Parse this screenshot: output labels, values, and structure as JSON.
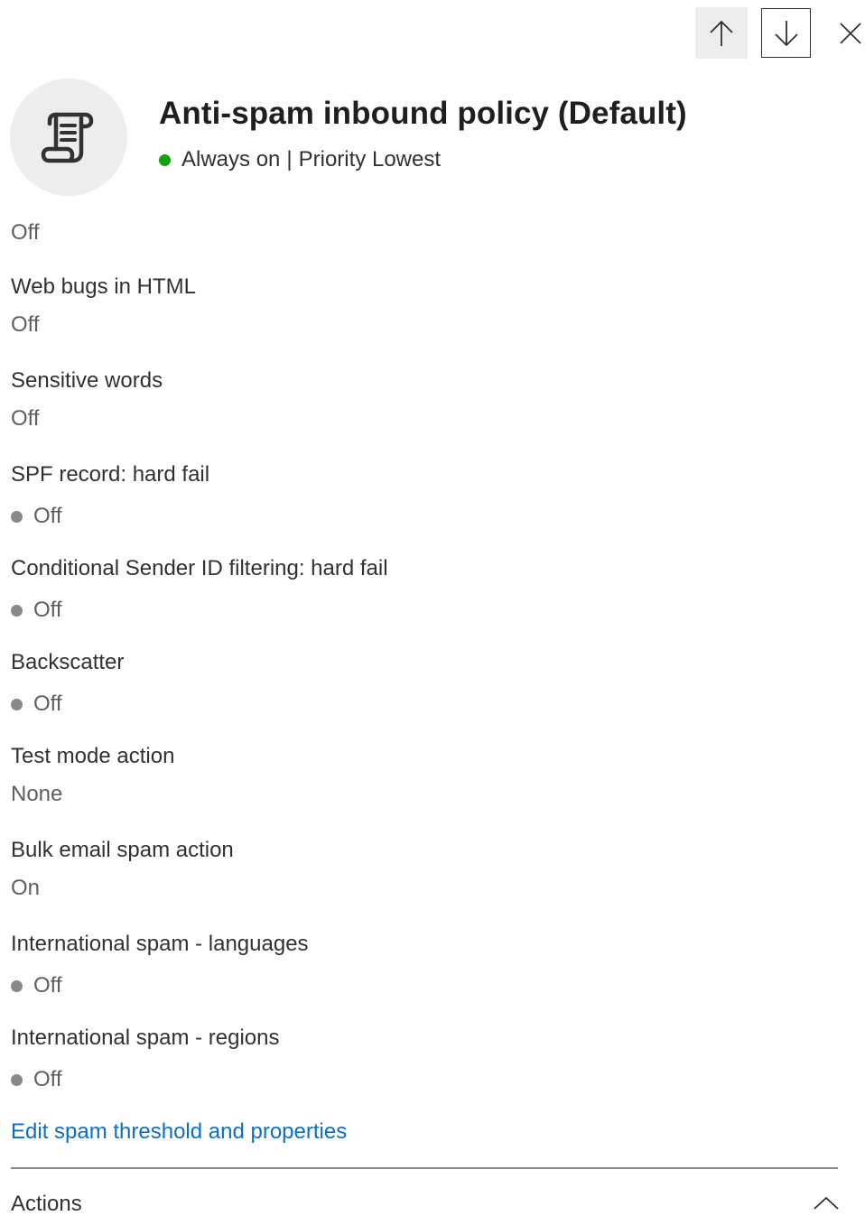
{
  "header": {
    "title": "Anti-spam inbound policy (Default)",
    "status_text": "Always on",
    "status_separator": "|",
    "priority_text": "Priority Lowest",
    "status_color": "#13a10e",
    "icon": "policy-scroll-icon"
  },
  "nav": {
    "up_icon": "arrow-up-icon",
    "down_icon": "arrow-down-icon",
    "close_icon": "close-icon"
  },
  "top_value": "Off",
  "settings": [
    {
      "label": "Web bugs in HTML",
      "value": "Off",
      "dot": false
    },
    {
      "label": "Sensitive words",
      "value": "Off",
      "dot": false
    },
    {
      "label": "SPF record: hard fail",
      "value": "Off",
      "dot": true
    },
    {
      "label": "Conditional Sender ID filtering: hard fail",
      "value": "Off",
      "dot": true
    },
    {
      "label": "Backscatter",
      "value": "Off",
      "dot": true
    },
    {
      "label": "Test mode action",
      "value": "None",
      "dot": false
    },
    {
      "label": "Bulk email spam action",
      "value": "On",
      "dot": false
    },
    {
      "label": "International spam - languages",
      "value": "Off",
      "dot": true
    },
    {
      "label": "International spam - regions",
      "value": "Off",
      "dot": true
    }
  ],
  "edit_link": "Edit spam threshold and properties",
  "actions": {
    "title": "Actions",
    "toggle_icon": "chevron-up-icon"
  },
  "colors": {
    "link": "#106ebe",
    "off_dot": "#8a8886",
    "on_dot": "#13a10e"
  }
}
